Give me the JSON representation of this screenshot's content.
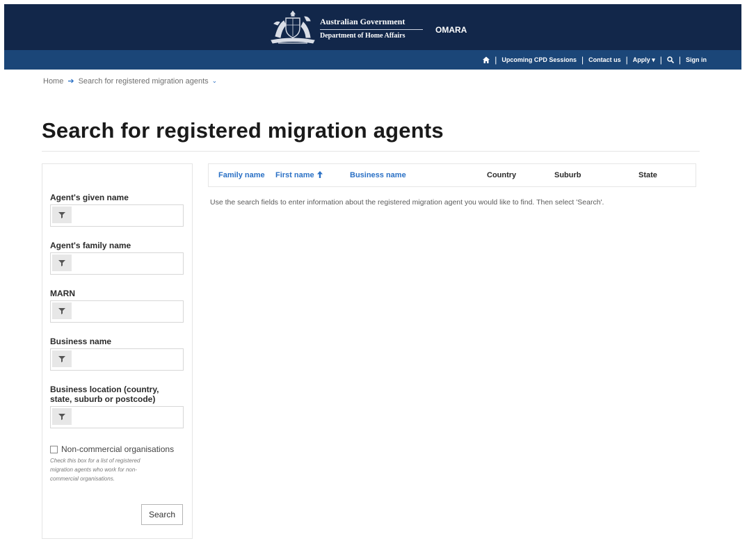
{
  "header": {
    "gov_line1": "Australian Government",
    "gov_line2": "Department of Home Affairs",
    "app_name": "OMARA"
  },
  "nav": {
    "home_icon": "home-icon",
    "upcoming": "Upcoming CPD Sessions",
    "contact": "Contact us",
    "apply": "Apply ▾",
    "search_icon": "search-icon",
    "sign_in": "Sign in"
  },
  "breadcrumb": {
    "home": "Home",
    "current": "Search for registered migration agents"
  },
  "page": {
    "title": "Search for registered migration agents"
  },
  "filters": {
    "given_name_label": "Agent's given name",
    "family_name_label": "Agent's family name",
    "marn_label": "MARN",
    "business_name_label": "Business name",
    "location_label_1": "Business location (country,",
    "location_label_2": "state, suburb or postcode)",
    "given_name_value": "",
    "family_name_value": "",
    "marn_value": "",
    "business_name_value": "",
    "location_value": "",
    "noncommercial_label": "Non-commercial organisations",
    "noncommercial_checked": false,
    "noncommercial_help_1": "Check this box for a list of registered",
    "noncommercial_help_2": "migration agents who work for non-",
    "noncommercial_help_3": "commercial organisations.",
    "search_button": "Search"
  },
  "table": {
    "columns": [
      "Family name",
      "First name",
      "Business name",
      "Country",
      "Suburb",
      "State"
    ],
    "sorted_column": "First name",
    "sort_direction": "ascending",
    "message": "Use the search fields to enter information about the registered migration agent you would like to find. Then select 'Search'."
  },
  "colors": {
    "header_bg": "#12274a",
    "nav_bg": "#1b4678",
    "link": "#2a70c5"
  }
}
